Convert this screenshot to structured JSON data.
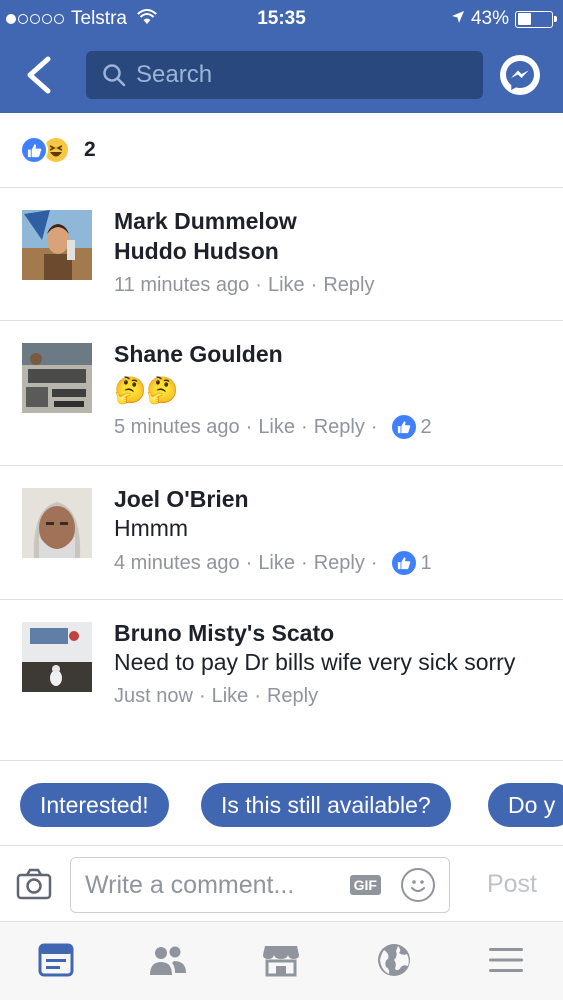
{
  "status_bar": {
    "carrier": "Telstra",
    "time": "15:35",
    "battery": "43%",
    "battery_level": 0.43
  },
  "header": {
    "search_placeholder": "Search",
    "back_icon": "chevron-left-icon",
    "messenger_icon": "messenger-icon"
  },
  "reactions": {
    "count": "2",
    "types": [
      "like",
      "haha"
    ]
  },
  "comments": [
    {
      "name": "Mark Dummelow",
      "text": "Huddo Hudson",
      "time": "11 minutes ago",
      "like_label": "Like",
      "reply_label": "Reply",
      "text_bold": true
    },
    {
      "name": "Shane Goulden",
      "text": "🤔🤔",
      "time": "5 minutes ago",
      "like_label": "Like",
      "reply_label": "Reply",
      "likes": "2"
    },
    {
      "name": "Joel O'Brien",
      "text": "Hmmm",
      "time": "4 minutes ago",
      "like_label": "Like",
      "reply_label": "Reply",
      "likes": "1"
    },
    {
      "name": "Bruno Misty's Scato",
      "text": "Need to pay Dr bills  wife very sick sorry",
      "time": "Just now",
      "like_label": "Like",
      "reply_label": "Reply"
    }
  ],
  "quick_replies": [
    "Interested!",
    "Is this still available?",
    "Do y"
  ],
  "composer": {
    "placeholder": "Write a comment...",
    "gif_label": "GIF",
    "post_label": "Post"
  },
  "tabbar": {
    "items": [
      "news-feed-icon",
      "friends-icon",
      "marketplace-icon",
      "notifications-globe-icon",
      "menu-icon"
    ],
    "active": 0
  },
  "colors": {
    "brand": "#4267b2",
    "search_bg": "#29487d",
    "like_blue": "#4080ff",
    "meta_gray": "#90949c"
  }
}
